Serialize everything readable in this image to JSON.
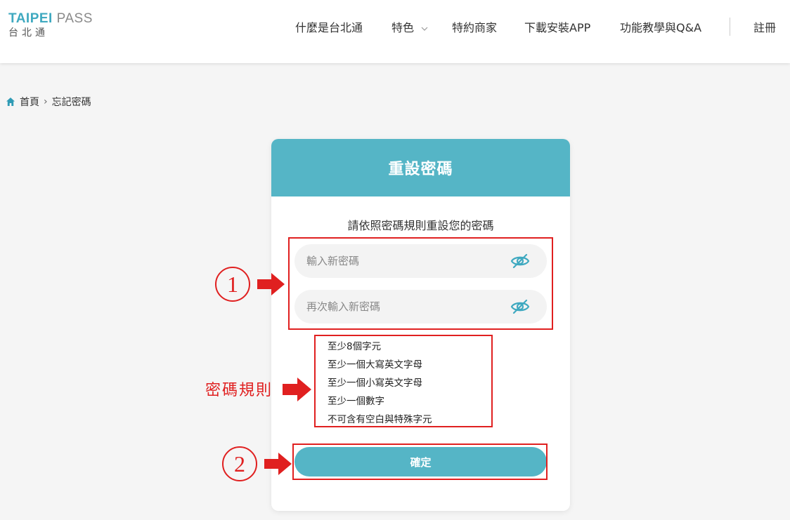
{
  "header": {
    "logo": {
      "brand": "TAIPEI",
      "pass": " PASS",
      "subtitle": "台北通"
    },
    "nav": [
      {
        "label": "什麼是台北通"
      },
      {
        "label": "特色"
      },
      {
        "label": "特約商家"
      },
      {
        "label": "下載安裝APP"
      },
      {
        "label": "功能教學與Q&A"
      }
    ],
    "register_label": "註冊"
  },
  "breadcrumb": {
    "home": "首頁",
    "separator": "›",
    "current": "忘記密碼"
  },
  "card": {
    "title": "重設密碼",
    "subtitle": "請依照密碼規則重設您的密碼",
    "new_password": {
      "placeholder": "輸入新密碼",
      "value": ""
    },
    "confirm_password": {
      "placeholder": "再次輸入新密碼",
      "value": ""
    },
    "rules": [
      "至少8個字元",
      "至少一個大寫英文字母",
      "至少一個小寫英文字母",
      "至少一個數字",
      "不可含有空白與特殊字元"
    ],
    "submit_label": "確定"
  },
  "annotations": {
    "step1": "1",
    "step2": "2",
    "rules_label": "密碼規則"
  },
  "colors": {
    "brand_teal": "#55b5c6",
    "annotation_red": "#e02020",
    "icon_teal": "#3fa9c0"
  },
  "icons": {
    "home": "home-icon",
    "chevron": "chevron-down-icon",
    "eye": "eye-off-icon",
    "arrow": "arrow-right-icon"
  }
}
